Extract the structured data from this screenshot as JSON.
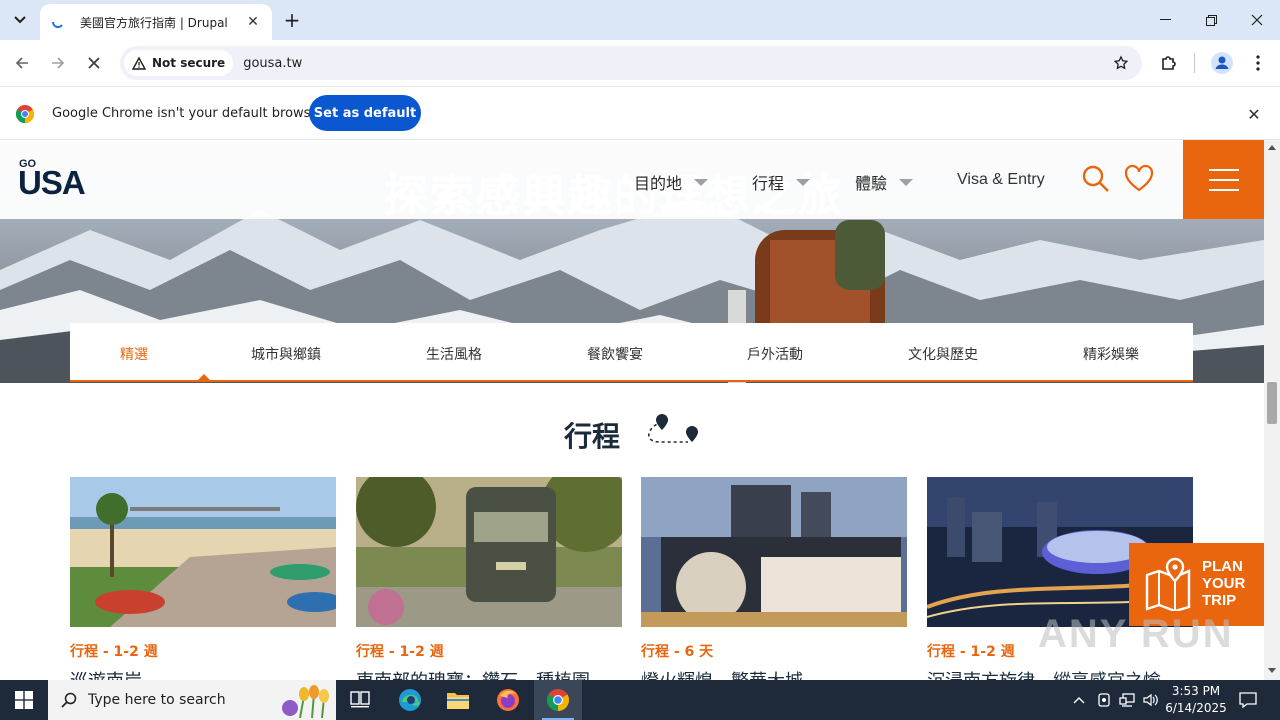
{
  "browser": {
    "tab_title": "美國官方旅行指南 | Drupal",
    "security_label": "Not secure",
    "url": "gousa.tw",
    "infobar_text": "Google Chrome isn't your default browser",
    "infobar_button": "Set as default"
  },
  "site": {
    "logo_go": "GO",
    "logo_usa": "USA",
    "hero_text": "探索感興趣的理想之旅",
    "nav": [
      {
        "label": "目的地"
      },
      {
        "label": "行程"
      },
      {
        "label": "體驗"
      }
    ],
    "visa": "Visa & Entry",
    "categories": [
      "精選",
      "城市與鄉鎮",
      "生活風格",
      "餐飲饗宴",
      "戶外活動",
      "文化與歷史",
      "精彩娛樂"
    ],
    "section_title": "行程",
    "cards": [
      {
        "meta": "行程 - 1-2 週",
        "title": "巡遊南岸"
      },
      {
        "meta": "行程 - 1-2 週",
        "title": "東南部的瑰寶：鑽石、種植園、"
      },
      {
        "meta": "行程 - 6 天",
        "title": "燈火輝煌，繁華大城"
      },
      {
        "meta": "行程 - 1-2 週",
        "title": "沉浸南方旋律，縱享感官之愉"
      }
    ],
    "plan_trip": [
      "PLAN",
      "YOUR",
      "TRIP"
    ],
    "watermark": "ANY RUN",
    "accent_color": "#e9660f",
    "navy_color": "#0c2340"
  },
  "taskbar": {
    "search_placeholder": "Type here to search",
    "time": "3:53 PM",
    "date": "6/14/2025"
  }
}
